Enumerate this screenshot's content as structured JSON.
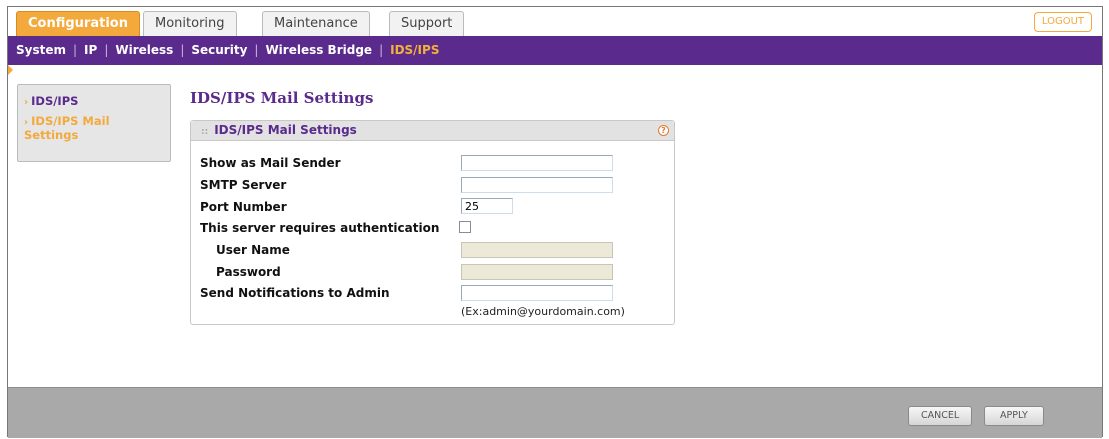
{
  "tabs": [
    {
      "label": "Configuration",
      "active": true
    },
    {
      "label": "Monitoring",
      "active": false
    },
    {
      "label": "Maintenance",
      "active": false
    },
    {
      "label": "Support",
      "active": false
    }
  ],
  "logout_label": "LOGOUT",
  "subnav": [
    "System",
    "IP",
    "Wireless",
    "Security",
    "Wireless Bridge",
    "IDS/IPS"
  ],
  "subnav_active": "IDS/IPS",
  "sidemenu": [
    {
      "label": "IDS/IPS",
      "active": false
    },
    {
      "label": "IDS/IPS Mail Settings",
      "active": true
    }
  ],
  "page_title": "IDS/IPS Mail Settings",
  "panel": {
    "title": "IDS/IPS Mail Settings",
    "help_icon": "?",
    "fields": {
      "mail_sender_label": "Show as Mail Sender",
      "mail_sender_value": "",
      "smtp_label": "SMTP Server",
      "smtp_value": "",
      "port_label": "Port Number",
      "port_value": "25",
      "auth_label": "This server requires authentication",
      "auth_checked": false,
      "username_label": "User Name",
      "username_value": "",
      "password_label": "Password",
      "password_value": "",
      "notify_label": "Send Notifications to Admin",
      "notify_value": "",
      "notify_hint": "(Ex:admin@yourdomain.com)"
    }
  },
  "buttons": {
    "cancel": "CANCEL",
    "apply": "APPLY"
  },
  "colors": {
    "accent_orange": "#f3a93b",
    "nav_purple": "#5a2a8c"
  }
}
